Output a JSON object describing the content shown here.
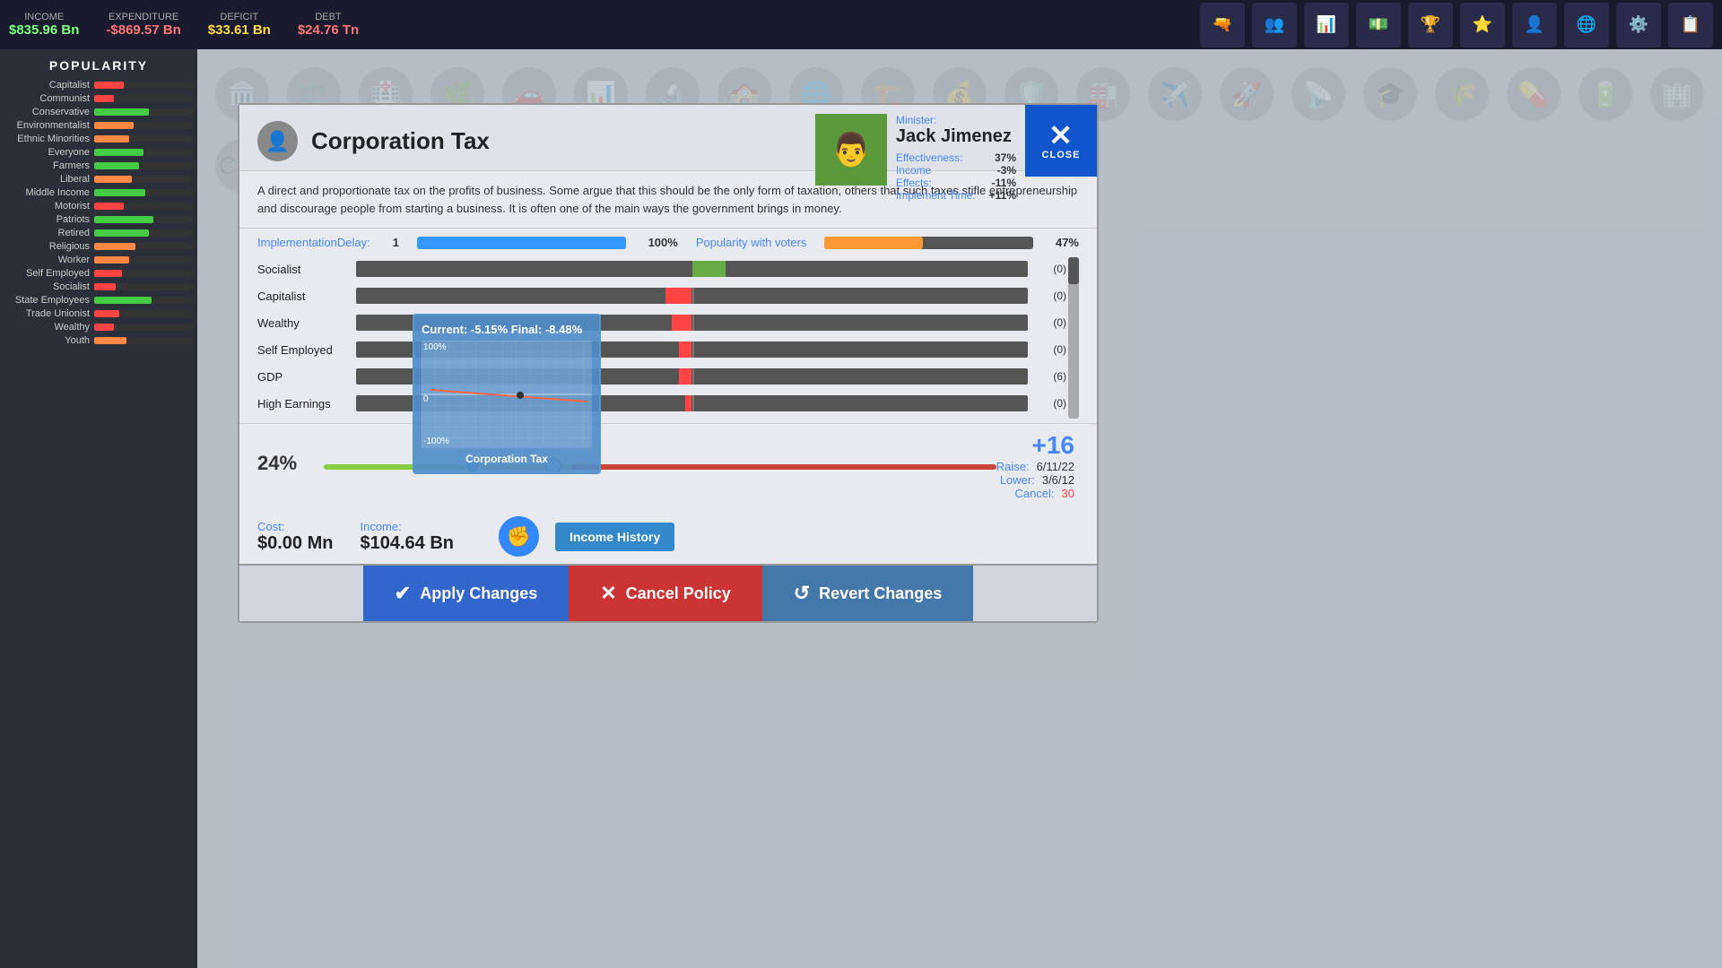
{
  "topBar": {
    "income_label": "INCOME",
    "income_value": "$835.96 Bn",
    "expenditure_label": "EXPENDITURE",
    "expenditure_value": "-$869.57 Bn",
    "deficit_label": "DEFICIT",
    "deficit_value": "$33.61 Bn",
    "debt_label": "DEBT",
    "debt_value": "$24.76 Tn"
  },
  "sidebar": {
    "title": "POPULARITY",
    "groups": [
      {
        "label": "Capitalist",
        "pct": 30,
        "color": "red"
      },
      {
        "label": "Communist",
        "pct": 20,
        "color": "red"
      },
      {
        "label": "Conservative",
        "pct": 55,
        "color": "green"
      },
      {
        "label": "Environmentalist",
        "pct": 40,
        "color": "orange"
      },
      {
        "label": "Ethnic Minorities",
        "pct": 35,
        "color": "orange"
      },
      {
        "label": "Everyone",
        "pct": 50,
        "color": "green"
      },
      {
        "label": "Farmers",
        "pct": 45,
        "color": "green"
      },
      {
        "label": "Liberal",
        "pct": 38,
        "color": "orange"
      },
      {
        "label": "Middle Income",
        "pct": 52,
        "color": "green"
      },
      {
        "label": "Motorist",
        "pct": 30,
        "color": "red"
      },
      {
        "label": "Patriots",
        "pct": 60,
        "color": "green"
      },
      {
        "label": "Retired",
        "pct": 55,
        "color": "green"
      },
      {
        "label": "Religious",
        "pct": 42,
        "color": "orange"
      },
      {
        "label": "Worker",
        "pct": 35,
        "color": "orange"
      },
      {
        "label": "Self Employed",
        "pct": 28,
        "color": "red"
      },
      {
        "label": "Socialist",
        "pct": 22,
        "color": "red"
      },
      {
        "label": "State Employees",
        "pct": 58,
        "color": "green"
      },
      {
        "label": "Trade Unionist",
        "pct": 25,
        "color": "red"
      },
      {
        "label": "Wealthy",
        "pct": 20,
        "color": "red"
      },
      {
        "label": "Youth",
        "pct": 33,
        "color": "orange"
      }
    ]
  },
  "modal": {
    "icon": "👤",
    "title": "Corporation Tax",
    "close_label": "CLOSE",
    "description": "A direct and proportionate tax on the profits of business. Some argue that this should be the only form of taxation, others that such taxes stifle entrepreneurship and discourage people from starting a business. It is often one of the main ways the government brings in money.",
    "impl_delay_label": "ImplementationDelay:",
    "impl_delay_val": "1",
    "impl_label": "Implementation:",
    "impl_val": "100%",
    "impl_bar_pct": 100,
    "popularity_label": "Popularity with voters",
    "popularity_val": "47%",
    "popularity_bar_pct": 47,
    "minister": {
      "label": "Minister:",
      "name": "Jack Jimenez",
      "effectiveness_label": "Effectiveness:",
      "effectiveness_val": "37%",
      "income_label": "Income",
      "income_val": "-3%",
      "effects_label": "Effects:",
      "effects_val": "-11%",
      "implement_time_label": "Implement Time:",
      "implement_time_val": "+11%"
    },
    "voters": [
      {
        "label": "Socialist",
        "offset": 0.5,
        "direction": "positive",
        "width": 5,
        "count": "(0)"
      },
      {
        "label": "Capitalist",
        "offset": 0.5,
        "direction": "negative",
        "width": 4,
        "count": "(0)"
      },
      {
        "label": "Wealthy",
        "offset": 0.5,
        "direction": "negative",
        "width": 3,
        "count": "(0)"
      },
      {
        "label": "Self Employed",
        "offset": 0.5,
        "direction": "negative",
        "width": 2,
        "count": "(0)"
      },
      {
        "label": "GDP",
        "offset": 0.5,
        "direction": "negative",
        "width": 2,
        "count": "(6)"
      },
      {
        "label": "High Earnings",
        "offset": 0.5,
        "direction": "negative",
        "width": 1,
        "count": "(0)"
      }
    ],
    "rate_pct": "24%",
    "cost_label": "Cost:",
    "cost_val": "$0.00 Mn",
    "income_hist_label": "Income History",
    "income_label": "Income:",
    "income_val": "$104.64 Bn",
    "raise_section": {
      "big_num": "+16",
      "raise_label": "Raise:",
      "raise_val": "6/11/22",
      "lower_label": "Lower:",
      "lower_val": "3/6/12",
      "cancel_label": "Cancel:",
      "cancel_val": "30"
    },
    "tooltip": {
      "title": "Current: -5.15% Final: -8.48%",
      "y_top": "100%",
      "y_mid": "0",
      "y_bot": "-100%",
      "footer": "Corporation Tax"
    },
    "buttons": {
      "apply": "Apply Changes",
      "cancel_policy": "Cancel Policy",
      "revert": "Revert Changes"
    }
  }
}
